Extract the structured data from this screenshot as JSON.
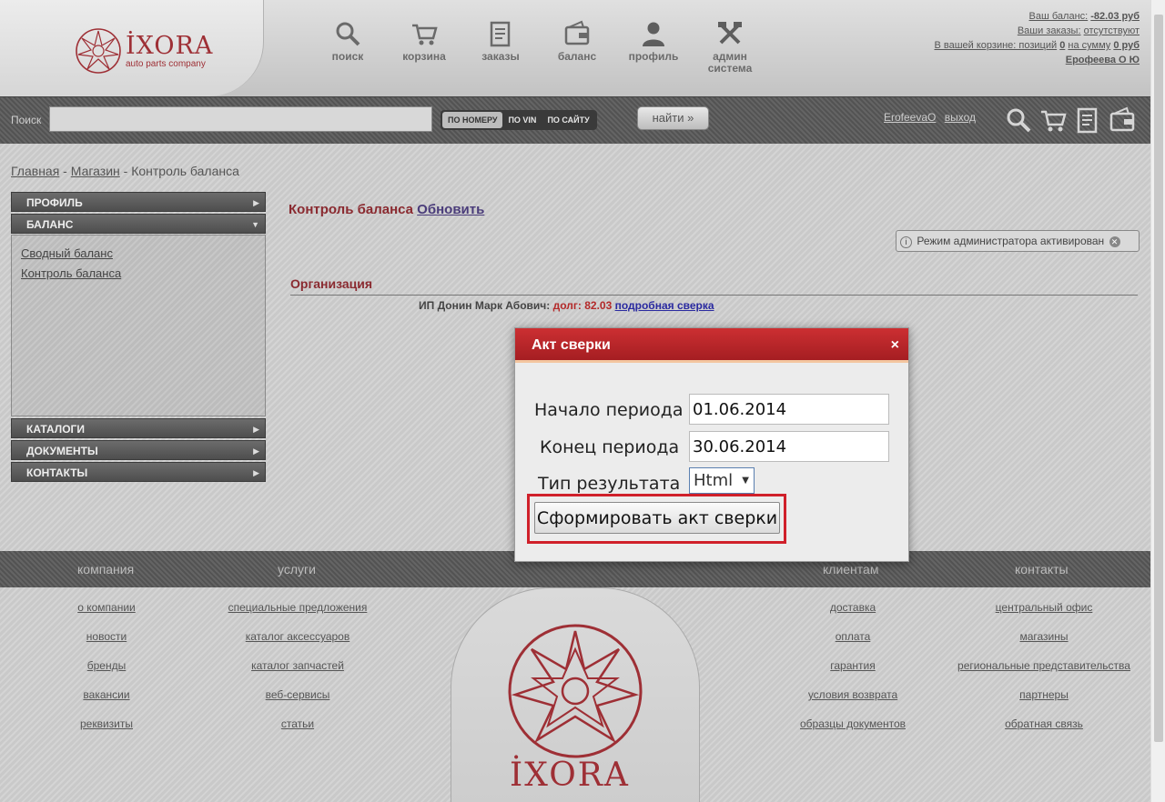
{
  "brand": {
    "name": "İXORA",
    "tagline": "auto parts company"
  },
  "topnav": [
    {
      "label": "поиск",
      "icon": "search-icon"
    },
    {
      "label": "корзина",
      "icon": "cart-icon"
    },
    {
      "label": "заказы",
      "icon": "orders-icon"
    },
    {
      "label": "баланс",
      "icon": "wallet-icon"
    },
    {
      "label": "профиль",
      "icon": "user-icon"
    },
    {
      "label": "админ система",
      "icon": "tools-icon"
    }
  ],
  "account": {
    "balance_label": "Ваш баланс:",
    "balance_value": "-82.03 руб",
    "orders_label": "Ваши заказы:",
    "orders_value": "отсутствуют",
    "cart_prefix": "В вашей корзине: позиций",
    "cart_positions": "0",
    "cart_sum_label": "на сумму",
    "cart_sum": "0 руб",
    "user_name": "Ерофеева О Ю"
  },
  "search": {
    "label": "Поиск",
    "placeholder": "",
    "modes": [
      "ПО НОМЕРУ",
      "ПО VIN",
      "ПО САЙТУ"
    ],
    "active_mode": "ПО НОМЕРУ",
    "button": "найти »",
    "user_link": "ErofeevaO",
    "logout_link": "выход"
  },
  "breadcrumb": {
    "home": "Главная",
    "sep": " - ",
    "shop": "Магазин",
    "current": "Контроль баланса"
  },
  "sidebar": {
    "profile": "ПРОФИЛЬ",
    "balance": "БАЛАНС",
    "balance_items": [
      "Сводный баланс",
      "Контроль баланса"
    ],
    "catalogs": "КАТАЛОГИ",
    "documents": "ДОКУМЕНТЫ",
    "contacts": "КОНТАКТЫ"
  },
  "main": {
    "title": "Контроль баланса",
    "refresh": "Обновить",
    "admin_notice": "Режим администратора активирован",
    "org_header": "Организация",
    "org_name": "ИП Донин Марк Абович:",
    "debt": "долг: 82.03",
    "detail_link": "подробная сверка"
  },
  "modal": {
    "title": "Акт сверки",
    "close": "×",
    "start_label": "Начало периода",
    "start_value": "01.06.2014",
    "end_label": "Конец периода",
    "end_value": "30.06.2014",
    "type_label": "Тип результата",
    "type_value": "Html",
    "submit": "Сформировать акт сверки"
  },
  "footer": {
    "headers": [
      "компания",
      "услуги",
      "клиентам",
      "контакты"
    ],
    "company": [
      "о компании",
      "новости",
      "бренды",
      "вакансии",
      "реквизиты"
    ],
    "services": [
      "специальные предложения",
      "каталог аксессуаров",
      "каталог запчастей",
      "веб-сервисы",
      "статьи"
    ],
    "clients": [
      "доставка",
      "оплата",
      "гарантия",
      "условия возврата",
      "образцы документов"
    ],
    "contacts": [
      "центральный офис",
      "магазины",
      "региональные представительства",
      "партнеры",
      "обратная связь"
    ],
    "brand": "İXORA"
  },
  "colors": {
    "accent": "#9e2f35",
    "modal_header": "#b3262a",
    "highlight": "#d0202a"
  }
}
